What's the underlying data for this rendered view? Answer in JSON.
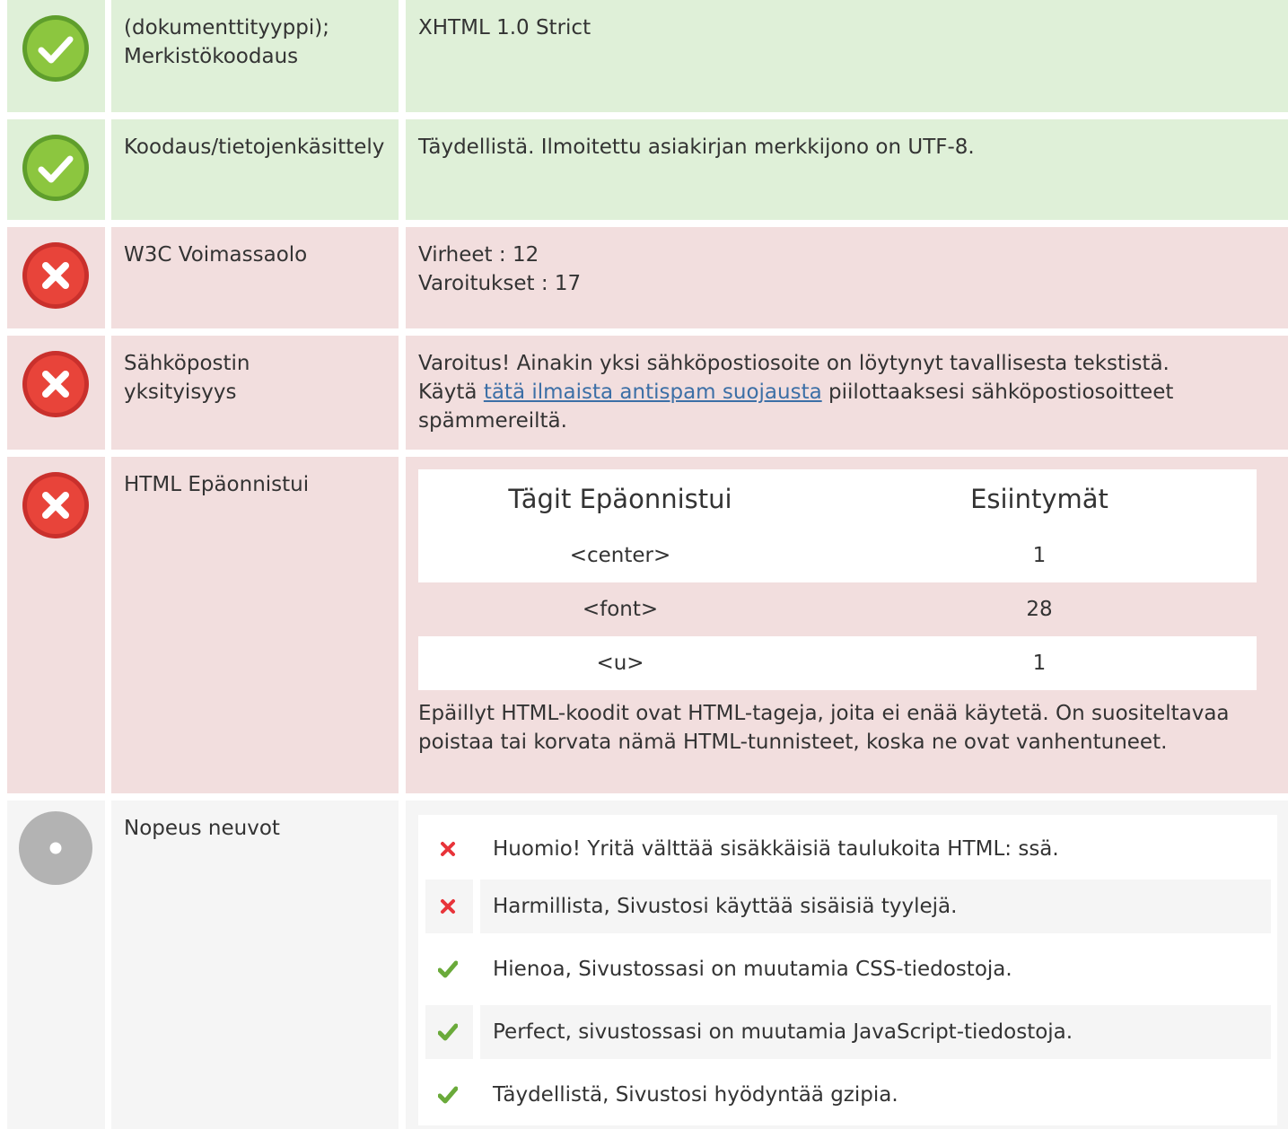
{
  "colors": {
    "good_bg": "#dff0d8",
    "bad_bg": "#f2dede",
    "neutral_bg": "#f5f5f5",
    "link": "#3c6fa6",
    "check_green": "#6aaa3a",
    "cross_red": "#e8343a"
  },
  "rows": [
    {
      "status": "pass",
      "icon": "check-circle-icon",
      "label": "(dokumenttityyppi); Merkistökoodaus",
      "value": "XHTML 1.0 Strict"
    },
    {
      "status": "pass",
      "icon": "check-circle-icon",
      "label": "Koodaus/tietojenkäsittely",
      "value": "Täydellistä. Ilmoitettu asiakirjan merkkijono on UTF-8."
    },
    {
      "status": "fail",
      "icon": "cross-circle-icon",
      "label": "W3C Voimassaolo",
      "value_line1": "Virheet : 12",
      "value_line2": "Varoitukset : 17"
    },
    {
      "status": "fail",
      "icon": "cross-circle-icon",
      "label": "Sähköpostin yksityisyys",
      "value_before": "Varoitus! Ainakin yksi sähköpostiosoite on löytynyt tavallisesta tekstistä. Käytä ",
      "value_link": "tätä ilmaista antispam suojausta",
      "value_after": " piilottaaksesi sähköpostiosoitteet spämmereiltä."
    },
    {
      "status": "fail",
      "icon": "cross-circle-icon",
      "label": "HTML Epäonnistui",
      "table": {
        "headers": [
          "Tägit Epäonnistui",
          "Esiintymät"
        ],
        "rows": [
          [
            "<center>",
            "1"
          ],
          [
            "<font>",
            "28"
          ],
          [
            "<u>",
            "1"
          ]
        ]
      },
      "note": "Epäillyt HTML-koodit ovat HTML-tageja, joita ei enää käytetä. On suositeltavaa poistaa tai korvata nämä HTML-tunnisteet, koska ne ovat vanhentuneet."
    },
    {
      "status": "info",
      "icon": "neutral-circle-icon",
      "label": "Nopeus neuvot",
      "tips": [
        {
          "icon": "cross-icon",
          "text": "Huomio! Yritä välttää sisäkkäisiä taulukoita HTML: ssä."
        },
        {
          "icon": "cross-icon",
          "text": "Harmillista, Sivustosi käyttää sisäisiä tyylejä."
        },
        {
          "icon": "check-icon",
          "text": "Hienoa, Sivustossasi on muutamia CSS-tiedostoja."
        },
        {
          "icon": "check-icon",
          "text": "Perfect, sivustossasi on muutamia JavaScript-tiedostoja."
        },
        {
          "icon": "check-icon",
          "text": "Täydellistä, Sivustosi hyödyntää gzipia."
        }
      ]
    }
  ]
}
